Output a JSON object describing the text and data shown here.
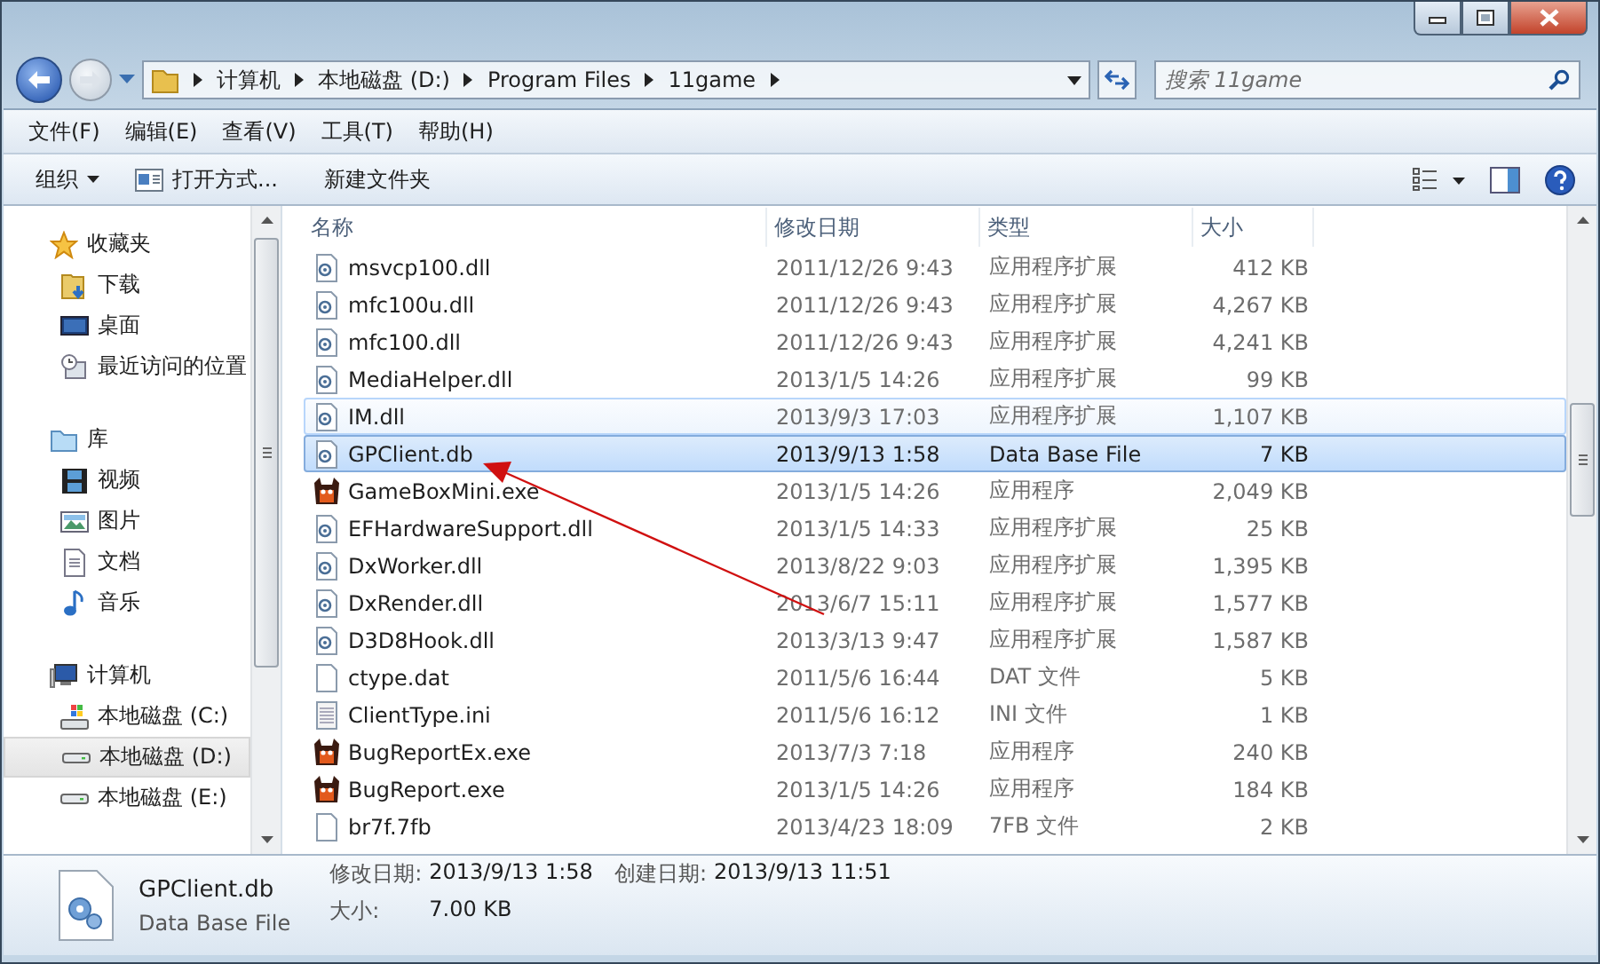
{
  "address_bar": {
    "crumbs": [
      "计算机",
      "本地磁盘 (D:)",
      "Program Files",
      "11game"
    ]
  },
  "search": {
    "placeholder": "搜索 11game"
  },
  "menu": [
    "文件(F)",
    "编辑(E)",
    "查看(V)",
    "工具(T)",
    "帮助(H)"
  ],
  "toolbar": [
    {
      "kind": "dropdown",
      "label": "组织"
    },
    {
      "kind": "open",
      "label": "打开方式..."
    },
    {
      "kind": "plain",
      "label": "新建文件夹"
    }
  ],
  "sidebar": {
    "groups": [
      {
        "label": "收藏夹",
        "kind": "star",
        "children": [
          {
            "label": "下载",
            "kind": "download",
            "selected": false
          },
          {
            "label": "桌面",
            "kind": "desktop",
            "selected": false
          },
          {
            "label": "最近访问的位置",
            "kind": "recent",
            "selected": false
          }
        ]
      },
      {
        "label": "库",
        "kind": "library",
        "children": [
          {
            "label": "视频",
            "kind": "video",
            "selected": false
          },
          {
            "label": "图片",
            "kind": "picture",
            "selected": false
          },
          {
            "label": "文档",
            "kind": "document",
            "selected": false
          },
          {
            "label": "音乐",
            "kind": "music",
            "selected": false
          }
        ]
      },
      {
        "label": "计算机",
        "kind": "computer",
        "children": [
          {
            "label": "本地磁盘 (C:)",
            "kind": "system-drive",
            "selected": false
          },
          {
            "label": "本地磁盘 (D:)",
            "kind": "drive",
            "selected": true
          },
          {
            "label": "本地磁盘 (E:)",
            "kind": "drive",
            "selected": false
          }
        ]
      }
    ]
  },
  "table": {
    "columns": [
      "名称",
      "修改日期",
      "类型",
      "大小"
    ],
    "rows": [
      {
        "kind": "dll",
        "name": "msvcp100.dll",
        "date": "2011/12/26 9:43",
        "type": "应用程序扩展",
        "size": "412 KB",
        "selected": false,
        "hovered": false
      },
      {
        "kind": "dll",
        "name": "mfc100u.dll",
        "date": "2011/12/26 9:43",
        "type": "应用程序扩展",
        "size": "4,267 KB",
        "selected": false,
        "hovered": false
      },
      {
        "kind": "dll",
        "name": "mfc100.dll",
        "date": "2011/12/26 9:43",
        "type": "应用程序扩展",
        "size": "4,241 KB",
        "selected": false,
        "hovered": false
      },
      {
        "kind": "dll",
        "name": "MediaHelper.dll",
        "date": "2013/1/5 14:26",
        "type": "应用程序扩展",
        "size": "99 KB",
        "selected": false,
        "hovered": false
      },
      {
        "kind": "dll",
        "name": "IM.dll",
        "date": "2013/9/3 17:03",
        "type": "应用程序扩展",
        "size": "1,107 KB",
        "selected": false,
        "hovered": true
      },
      {
        "kind": "dll",
        "name": "GPClient.db",
        "date": "2013/9/13 1:58",
        "type": "Data Base File",
        "size": "7 KB",
        "selected": true,
        "hovered": false
      },
      {
        "kind": "exe",
        "name": "GameBoxMini.exe",
        "date": "2013/1/5 14:26",
        "type": "应用程序",
        "size": "2,049 KB",
        "selected": false,
        "hovered": false
      },
      {
        "kind": "dll",
        "name": "EFHardwareSupport.dll",
        "date": "2013/1/5 14:33",
        "type": "应用程序扩展",
        "size": "25 KB",
        "selected": false,
        "hovered": false
      },
      {
        "kind": "dll",
        "name": "DxWorker.dll",
        "date": "2013/8/22 9:03",
        "type": "应用程序扩展",
        "size": "1,395 KB",
        "selected": false,
        "hovered": false
      },
      {
        "kind": "dll",
        "name": "DxRender.dll",
        "date": "2013/6/7 15:11",
        "type": "应用程序扩展",
        "size": "1,577 KB",
        "selected": false,
        "hovered": false
      },
      {
        "kind": "dll",
        "name": "D3D8Hook.dll",
        "date": "2013/3/13 9:47",
        "type": "应用程序扩展",
        "size": "1,587 KB",
        "selected": false,
        "hovered": false
      },
      {
        "kind": "file",
        "name": "ctype.dat",
        "date": "2011/5/6 16:44",
        "type": "DAT 文件",
        "size": "5 KB",
        "selected": false,
        "hovered": false
      },
      {
        "kind": "text",
        "name": "ClientType.ini",
        "date": "2011/5/6 16:12",
        "type": "INI 文件",
        "size": "1 KB",
        "selected": false,
        "hovered": false
      },
      {
        "kind": "exe",
        "name": "BugReportEx.exe",
        "date": "2013/7/3 7:18",
        "type": "应用程序",
        "size": "240 KB",
        "selected": false,
        "hovered": false
      },
      {
        "kind": "exe",
        "name": "BugReport.exe",
        "date": "2013/1/5 14:26",
        "type": "应用程序",
        "size": "184 KB",
        "selected": false,
        "hovered": false
      },
      {
        "kind": "file",
        "name": "br7f.7fb",
        "date": "2013/4/23 18:09",
        "type": "7FB 文件",
        "size": "2 KB",
        "selected": false,
        "hovered": false
      }
    ]
  },
  "details": {
    "name": "GPClient.db",
    "type": "Data Base File",
    "fields": [
      {
        "label": "修改日期:",
        "value": "2013/9/13 1:58"
      },
      {
        "label": "大小:",
        "value": "7.00 KB"
      },
      {
        "label": "创建日期:",
        "value": "2013/9/13 11:51"
      }
    ]
  }
}
